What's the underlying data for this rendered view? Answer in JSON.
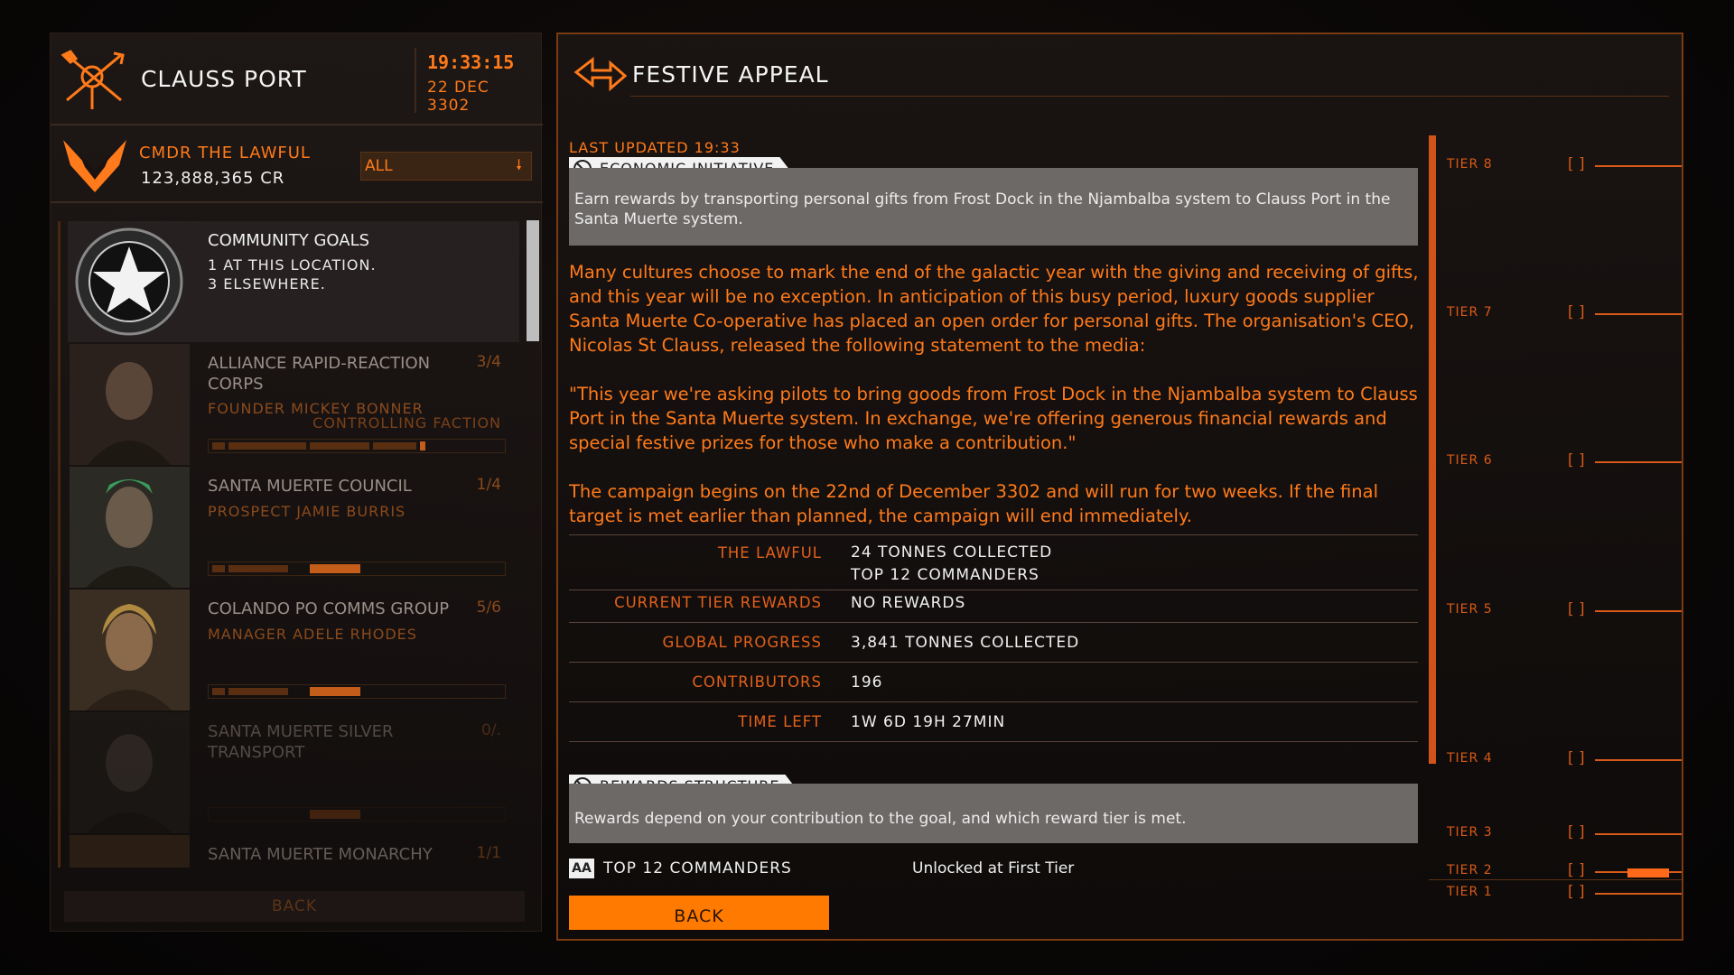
{
  "header": {
    "station": "CLAUSS PORT",
    "time": "19:33:15",
    "date": "22 DEC 3302"
  },
  "commander": {
    "name": "CMDR THE LAWFUL",
    "credits": "123,888,365 CR",
    "filter": "ALL"
  },
  "goals_list": [
    {
      "title": "COMMUNITY GOALS",
      "sub1": "1 AT THIS LOCATION.",
      "sub2": "3 ELSEWHERE."
    },
    {
      "title": "ALLIANCE RAPID-REACTION CORPS",
      "count": "3/4",
      "leader": "FOUNDER MICKEY BONNER",
      "faction": "CONTROLLING FACTION",
      "progress": 0.75
    },
    {
      "title": "SANTA MUERTE COUNCIL",
      "count": "1/4",
      "leader": "PROSPECT JAMIE BURRIS",
      "progress": 0.5
    },
    {
      "title": "COLANDO PO COMMS GROUP",
      "count": "5/6",
      "leader": "MANAGER ADELE RHODES",
      "progress": 0.5
    },
    {
      "title": "SANTA MUERTE SILVER TRANSPORT",
      "count": "0/.",
      "leader": "",
      "progress": 0.5
    },
    {
      "title": "SANTA MUERTE MONARCHY",
      "count": "1/1"
    }
  ],
  "left_back": "BACK",
  "detail": {
    "title": "FESTIVE APPEAL",
    "last_updated": "LAST UPDATED 19:33",
    "section1": "ECONOMIC INITIATIVE",
    "summary": "Earn rewards by transporting personal gifts from Frost Dock in the Njambalba system to Clauss Port in the Santa Muerte system.",
    "paragraphs": [
      "Many cultures choose to mark the end of the galactic year with the giving and receiving of gifts, and this year will be no exception. In anticipation of this busy period, luxury goods supplier Santa Muerte Co-operative has placed an open order for personal gifts. The organisation's CEO, Nicolas St Clauss, released the following statement to the media:",
      "\"This year we're asking pilots to bring goods from Frost Dock in the Njambalba system to Clauss Port in the Santa Muerte system. In exchange, we're offering generous financial rewards and special festive prizes for those who make a contribution.\"",
      "The campaign begins on the 22nd of December 3302 and will run for two weeks. If the final target is met earlier than planned, the campaign will end immediately."
    ],
    "stats": {
      "lawful_label": "THE LAWFUL",
      "lawful_val1": "24 TONNES COLLECTED",
      "lawful_val2": "TOP 12 COMMANDERS",
      "tier_label": "CURRENT TIER REWARDS",
      "tier_val": "NO REWARDS",
      "global_label": "GLOBAL PROGRESS",
      "global_val": "3,841 TONNES COLLECTED",
      "contrib_label": "CONTRIBUTORS",
      "contrib_val": "196",
      "time_label": "TIME LEFT",
      "time_val": "1W 6D 19H 27MIN"
    },
    "section2": "REWARDS STRUCTURE",
    "rewards_summary": "Rewards depend on your contribution to the goal, and which reward tier is met.",
    "reward_row": {
      "icon": "AA",
      "label": "TOP 12 COMMANDERS",
      "value": "Unlocked at First Tier"
    },
    "back": "BACK"
  },
  "tiers": [
    {
      "label": "TIER 8",
      "box": "[ ]"
    },
    {
      "label": "TIER 7",
      "box": "[ ]"
    },
    {
      "label": "TIER 6",
      "box": "[ ]"
    },
    {
      "label": "TIER 5",
      "box": "[ ]"
    },
    {
      "label": "TIER 4",
      "box": "[ ]"
    },
    {
      "label": "TIER 3",
      "box": "[ ]"
    },
    {
      "label": "TIER 2",
      "box": "[ ]"
    },
    {
      "label": "TIER 1",
      "box": "[ ]"
    }
  ],
  "colors": {
    "accent": "#ff7a1a",
    "panel_border": "#7a3a12",
    "grey_box": "#6d6967"
  },
  "icons": [
    "station-icon",
    "elite-rank-icon",
    "community-goals-icon",
    "back-arrow-icon",
    "section-tag-icon",
    "aa-icon"
  ]
}
